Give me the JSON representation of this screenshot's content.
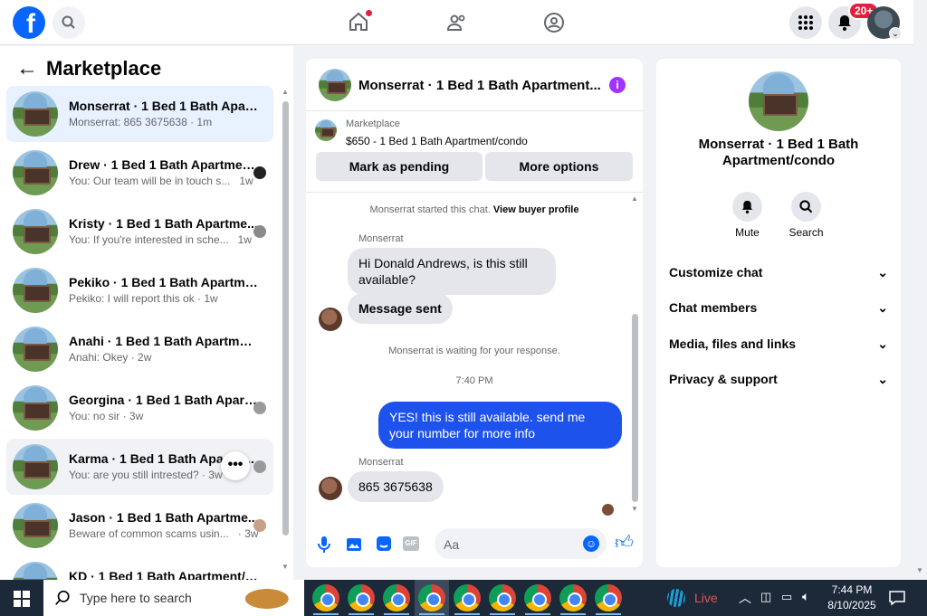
{
  "header": {
    "logo_letter": "f",
    "notif_count": "20+"
  },
  "left": {
    "title": "Marketplace",
    "conversations": [
      {
        "name": "Monserrat · 1 Bed 1 Bath Apart...",
        "preview": "Monserrat: 865 3675638 · 1m",
        "time": ""
      },
      {
        "name": "Drew · 1 Bed 1 Bath Apartmen...",
        "preview": "You: Our team will be in touch s...",
        "time": "1w"
      },
      {
        "name": "Kristy · 1 Bed 1 Bath Apartme...",
        "preview": "You: If you're interested in sche...",
        "time": "1w"
      },
      {
        "name": "Pekiko · 1 Bed 1 Bath Apartment...",
        "preview": "Pekiko: I will report this ok · 1w",
        "time": ""
      },
      {
        "name": "Anahi · 1 Bed 1 Bath Apartment/...",
        "preview": "Anahi: Okey · 2w",
        "time": ""
      },
      {
        "name": "Georgina · 1 Bed 1 Bath Apart...",
        "preview": "You: no sir · 3w",
        "time": ""
      },
      {
        "name": "Karma · 1 Bed 1 Bath Apartm...",
        "preview": "You: are you still intrested? · 3w",
        "time": ""
      },
      {
        "name": "Jason · 1 Bed 1 Bath Apartme...",
        "preview": "Beware of common scams usin...",
        "time": "· 3w"
      },
      {
        "name": "KD · 1 Bed 1 Bath Apartment/co...",
        "preview": "",
        "time": ""
      }
    ]
  },
  "chat": {
    "title": "Monserrat · 1 Bed 1 Bath Apartment...",
    "listing_source": "Marketplace",
    "listing_title": "$650 - 1 Bed 1 Bath Apartment/condo",
    "mark_pending": "Mark as pending",
    "more_options": "More options",
    "started_text": "Monserrat started this chat.",
    "view_profile": "View buyer profile",
    "sender1": "Monserrat",
    "msg1": "Hi Donald Andrews, is this still available?",
    "msg2": "Message sent",
    "waiting": "Monserrat is waiting for your response.",
    "time": "7:40 PM",
    "msg_out": "YES! this is still available. send me your number for more info",
    "sender2": "Monserrat",
    "msg3": "865 3675638",
    "input_placeholder": "Aa",
    "gif_label": "GIF"
  },
  "info": {
    "name": "Monserrat · 1 Bed 1 Bath Apartment/condo",
    "mute": "Mute",
    "search": "Search",
    "sections": [
      "Customize chat",
      "Chat members",
      "Media, files and links",
      "Privacy & support"
    ]
  },
  "taskbar": {
    "search_placeholder": "Type here to search",
    "live": "Live",
    "time": "7:44 PM",
    "date": "8/10/2025"
  }
}
